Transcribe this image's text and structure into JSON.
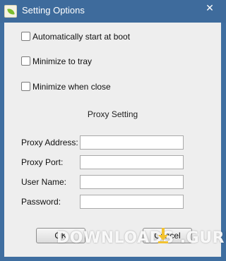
{
  "window": {
    "title": "Setting Options",
    "close_glyph": "✕"
  },
  "options": {
    "auto_start_label": "Automatically start at boot",
    "auto_start_checked": false,
    "minimize_tray_label": "Minimize to tray",
    "minimize_tray_checked": false,
    "minimize_close_label": "Minimize when close",
    "minimize_close_checked": false
  },
  "proxy": {
    "section_title": "Proxy Setting",
    "address_label": "Proxy Address:",
    "address_value": "",
    "port_label": "Proxy Port:",
    "port_value": "",
    "username_label": "User Name:",
    "username_value": "",
    "password_label": "Password:",
    "password_value": ""
  },
  "buttons": {
    "ok_label": "OK",
    "cancel_label": "Cancel"
  },
  "watermark": {
    "text": "DOWNLOADS  .GURU"
  },
  "colors": {
    "titlebar": "#3e6b9c",
    "content_bg": "#eeeeee",
    "accent_icon": "#7cbc2e"
  }
}
